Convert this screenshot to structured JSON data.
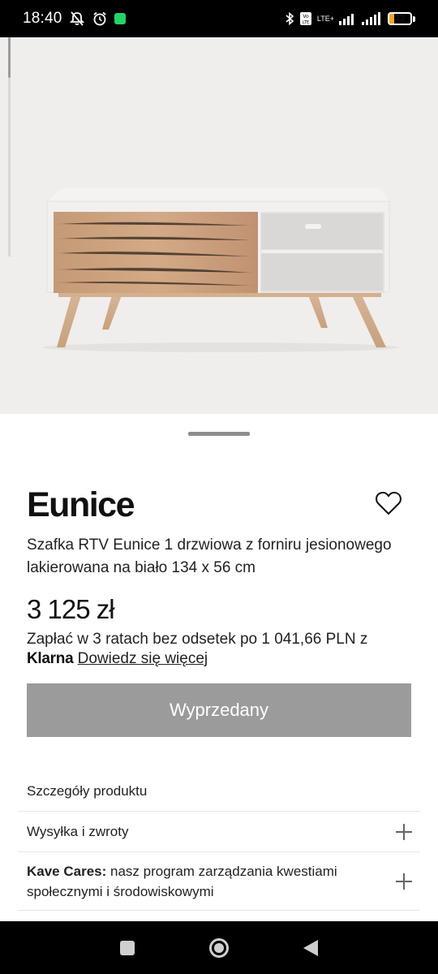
{
  "status_bar": {
    "time": "18:40",
    "network": "LTE+",
    "battery_level": 23,
    "battery_text": "23",
    "battery_color": "#f5a623"
  },
  "product": {
    "name": "Eunice",
    "description": "Szafka RTV Eunice 1 drzwiowa z forniru jesionowego lakierowana na biało 134 x 56 cm",
    "price": "3 125 zł",
    "installments_text": "Zapłać w 3 ratach bez odsetek po 1 041,66 PLN z",
    "klarna_label": "Klarna",
    "learn_more": "Dowiedz się więcej",
    "sold_out_label": "Wyprzedany",
    "sold_out_color": "#9b9b9b"
  },
  "accordions": {
    "details": "Szczegóły produktu",
    "shipping": "Wysyłka i zwroty",
    "cares_bold": "Kave Cares:",
    "cares_text": "nasz program zarządzania kwestiami społecznymi i środowiskowymi"
  },
  "icons": {
    "heart": "heart-icon",
    "plus": "plus-icon",
    "nav_recents": "square-icon",
    "nav_home": "circle-icon",
    "nav_back": "triangle-back-icon"
  }
}
